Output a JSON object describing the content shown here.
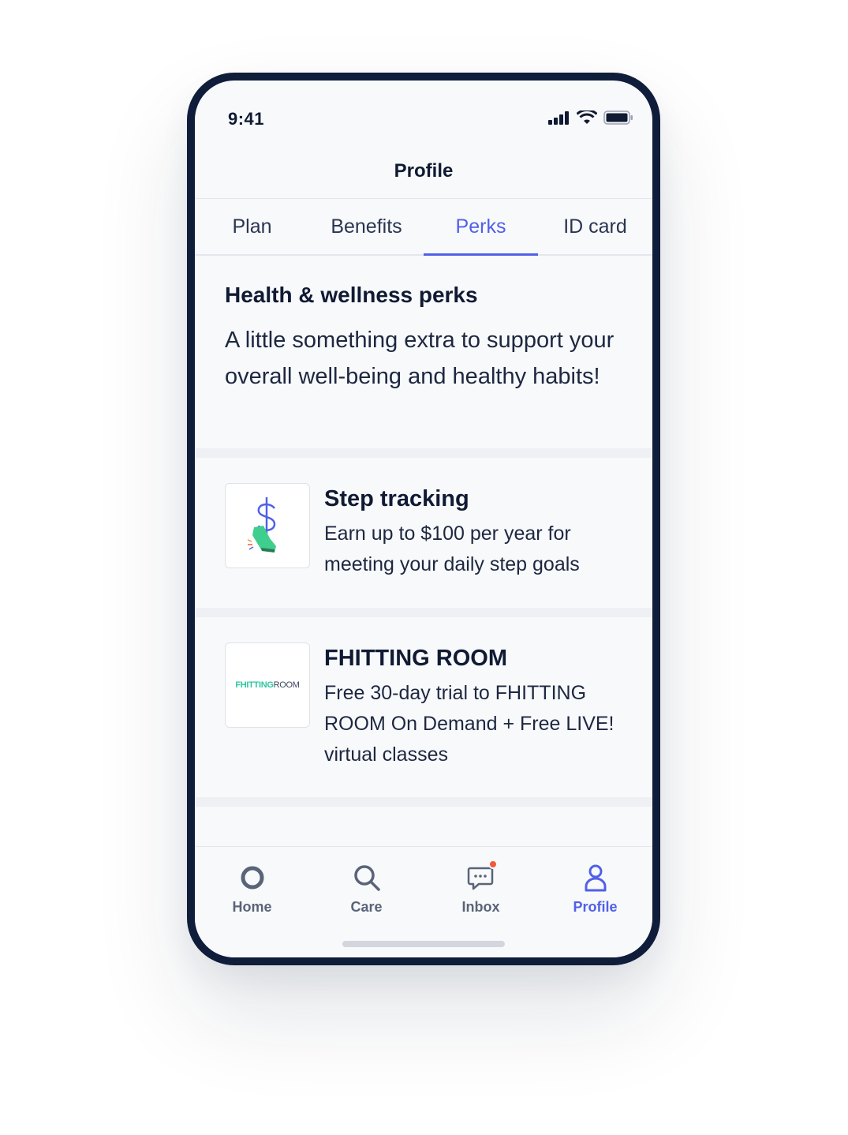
{
  "status_bar": {
    "time": "9:41",
    "icons": [
      "signal-icon",
      "wifi-icon",
      "battery-icon"
    ]
  },
  "header": {
    "title": "Profile"
  },
  "tabs": [
    {
      "label": "Plan",
      "active": false
    },
    {
      "label": "Benefits",
      "active": false
    },
    {
      "label": "Perks",
      "active": true
    },
    {
      "label": "ID card",
      "active": false
    }
  ],
  "intro": {
    "title": "Health & wellness perks",
    "body": "A little something extra to support your overall well-being and healthy habits!"
  },
  "perks": [
    {
      "title": "Step tracking",
      "description": "Earn up to $100 per year for meeting your daily step goals",
      "logo_icon": "sneaker-dollar-icon"
    },
    {
      "title": "FHITTING ROOM",
      "description": "Free 30-day trial to FHITTING ROOM On Demand + Free LIVE! virtual classes",
      "logo_text_primary": "FHITTING",
      "logo_text_secondary": "ROOM"
    }
  ],
  "bottom_nav": [
    {
      "label": "Home",
      "icon": "home-icon",
      "active": false
    },
    {
      "label": "Care",
      "icon": "search-icon",
      "active": false
    },
    {
      "label": "Inbox",
      "icon": "chat-icon",
      "active": false,
      "badge": true
    },
    {
      "label": "Profile",
      "icon": "person-icon",
      "active": true
    }
  ],
  "colors": {
    "accent": "#5060e8",
    "text_primary": "#101a33",
    "frame": "#0f1d3a",
    "badge": "#f05a3a",
    "logo_green": "#2ec7a0"
  }
}
